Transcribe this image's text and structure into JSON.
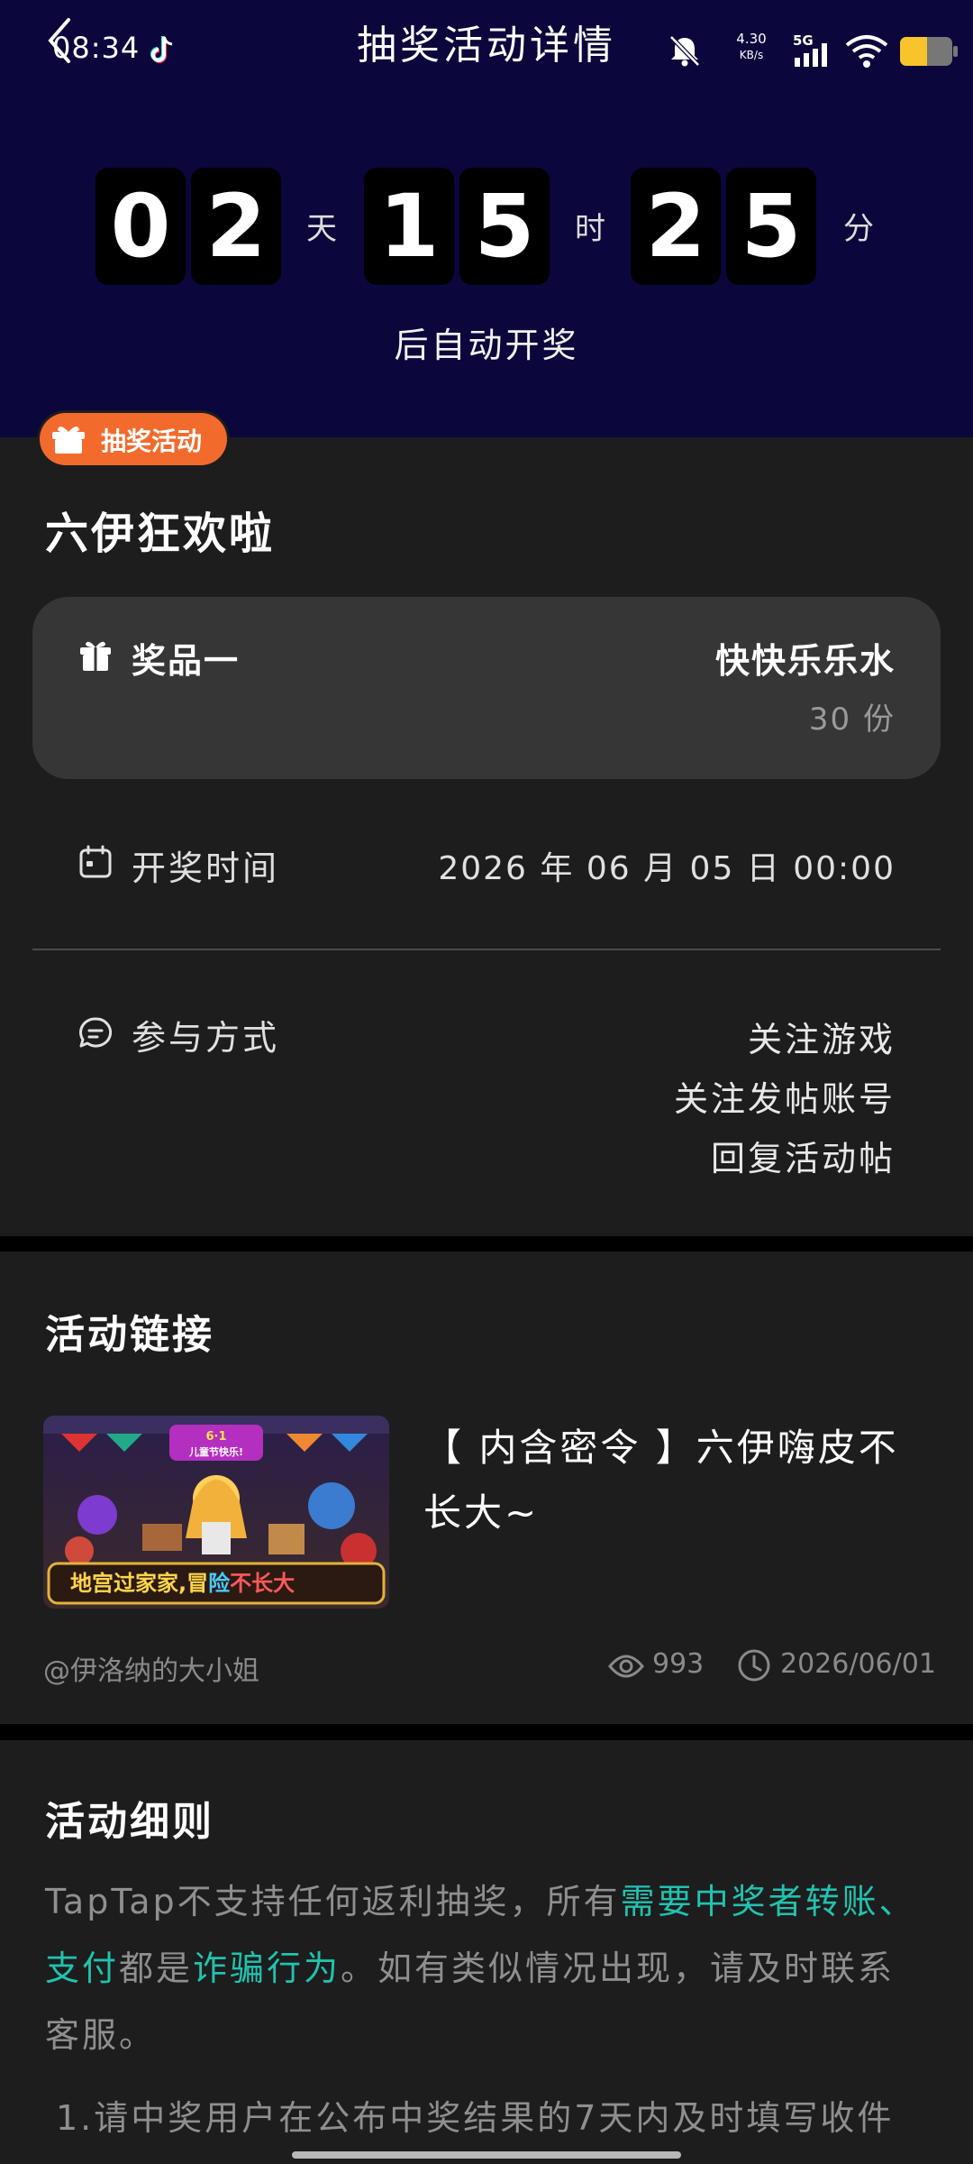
{
  "status_bar": {
    "time": "08:34",
    "net_speed_value": "4.30",
    "net_speed_unit": "KB/s",
    "network": "5G"
  },
  "header": {
    "title": "抽奖活动详情",
    "countdown": {
      "days": [
        "0",
        "2"
      ],
      "hours": [
        "1",
        "5"
      ],
      "minutes": [
        "2",
        "5"
      ],
      "day_unit": "天",
      "hour_unit": "时",
      "minute_unit": "分"
    },
    "caption": "后自动开奖"
  },
  "lottery": {
    "badge": "抽奖活动",
    "title": "六伊狂欢啦",
    "prize": {
      "label": "奖品一",
      "name": "快快乐乐水",
      "count": "30 份"
    },
    "draw_time": {
      "label": "开奖时间",
      "value": "2026 年 06 月 05 日 00:00"
    },
    "participation": {
      "label": "参与方式",
      "methods": [
        "关注游戏",
        "关注发帖账号",
        "回复活动帖"
      ]
    }
  },
  "activity_link": {
    "section_title": "活动链接",
    "title": "【 内含密令 】六伊嗨皮不长大~",
    "thumb_banner_top": "6·1",
    "thumb_banner_sub": "儿童节快乐!",
    "thumb_caption_a": "地宫过家家,冒",
    "thumb_caption_b": "险",
    "thumb_caption_c": "不长大",
    "author": "@伊洛纳的大小姐",
    "views": "993",
    "date": "2026/06/01"
  },
  "rules": {
    "section_title": "活动细则",
    "intro_a": "TapTap不支持任何返利抽奖，所有",
    "intro_hl1": "需要中奖者转账、支付",
    "intro_b": "都是",
    "intro_hl2": "诈骗行为",
    "intro_c": "。如有类似情况出现，请及时联系客服。",
    "item_1": "1.请中奖用户在公布中奖结果的7天内及时填写收件"
  },
  "colors": {
    "header_bg": "#0b063b",
    "badge": "#f26b2d",
    "highlight": "#21c2b0",
    "battery": "#f7c52b"
  },
  "icons": {
    "back": "chevron-left-icon",
    "gift": "gift-icon",
    "calendar": "calendar-icon",
    "chat": "chat-bubble-icon",
    "eye": "eye-icon",
    "clock": "clock-icon"
  }
}
